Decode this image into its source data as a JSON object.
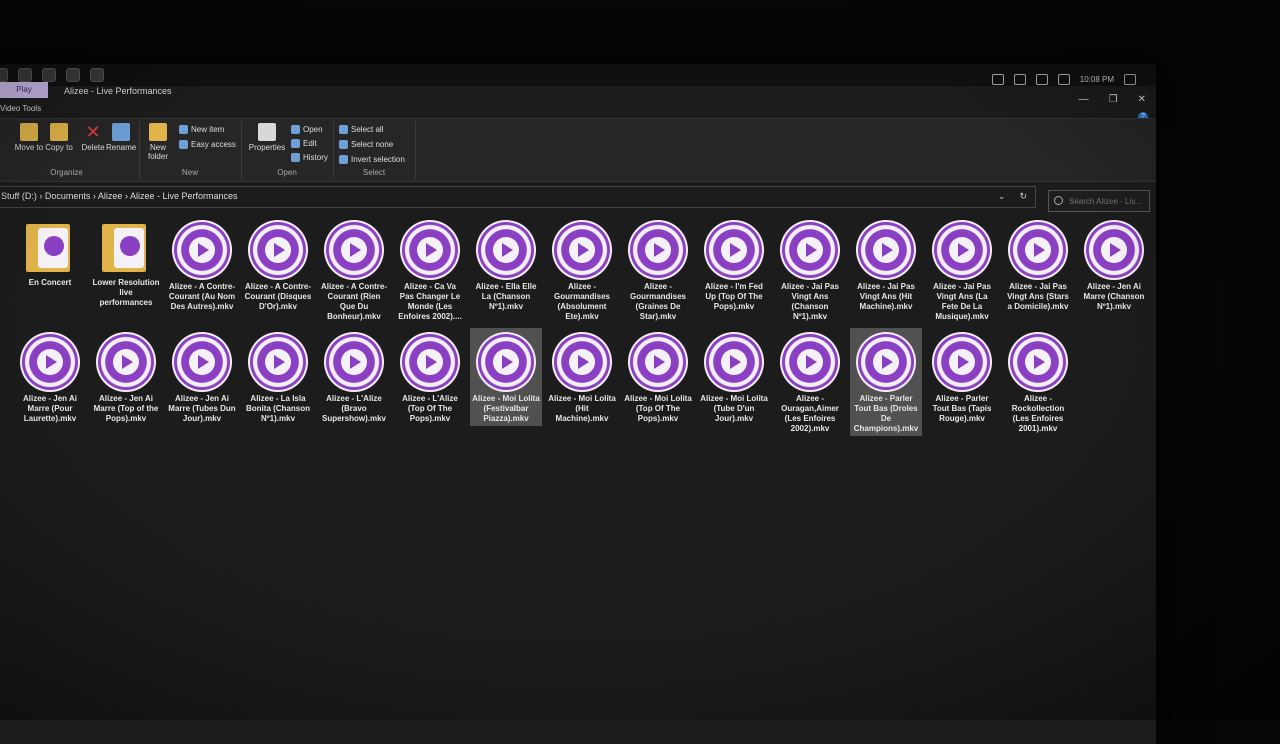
{
  "window": {
    "title": "Alizee - Live Performances",
    "context_tab": "Play",
    "context_group": "Video Tools",
    "clock": "10:08 PM"
  },
  "ribbon": {
    "organize": {
      "label": "Organize",
      "move_to": "Move to",
      "copy_to": "Copy to",
      "delete": "Delete",
      "rename": "Rename"
    },
    "new": {
      "label": "New",
      "new_folder": "New folder",
      "new_item": "New item",
      "easy_access": "Easy access"
    },
    "open": {
      "label": "Open",
      "properties": "Properties",
      "open": "Open",
      "edit": "Edit",
      "history": "History"
    },
    "select": {
      "label": "Select",
      "select_all": "Select all",
      "select_none": "Select none",
      "invert_selection": "Invert selection"
    }
  },
  "address": {
    "crumbs": [
      "Stuff (D:)",
      "Documents",
      "Alizee",
      "Alizee - Live Performances"
    ],
    "search_placeholder": "Search Alizee - Liv..."
  },
  "icons": {
    "play": "play-circle-icon",
    "folder": "folder-icon"
  },
  "colors": {
    "accent": "#8b3fc2",
    "background": "#1c1c1c",
    "selection": "#5a5a5a"
  },
  "items": [
    {
      "name": "En Concert",
      "kind": "folder",
      "selected": false
    },
    {
      "name": "Lower Resolution live performances",
      "kind": "folder",
      "selected": false
    },
    {
      "name": "Alizee - A Contre-Courant (Au Nom Des Autres).mkv",
      "kind": "video",
      "selected": false
    },
    {
      "name": "Alizee - A Contre-Courant (Disques D'Or).mkv",
      "kind": "video",
      "selected": false
    },
    {
      "name": "Alizee - A Contre-Courant (Rien Que Du Bonheur).mkv",
      "kind": "video",
      "selected": false
    },
    {
      "name": "Alizee - Ca Va Pas Changer Le Monde (Les Enfoires 2002)....",
      "kind": "video",
      "selected": false
    },
    {
      "name": "Alizee - Ella Elle La (Chanson Nº1).mkv",
      "kind": "video",
      "selected": false
    },
    {
      "name": "Alizee - Gourmandises (Absolument Ete).mkv",
      "kind": "video",
      "selected": false
    },
    {
      "name": "Alizee - Gourmandises (Graines De Star).mkv",
      "kind": "video",
      "selected": false
    },
    {
      "name": "Alizee - I'm Fed Up (Top Of The Pops).mkv",
      "kind": "video",
      "selected": false
    },
    {
      "name": "Alizee - Jai Pas Vingt Ans (Chanson Nº1).mkv",
      "kind": "video",
      "selected": false
    },
    {
      "name": "Alizee - Jai Pas Vingt Ans (Hit Machine).mkv",
      "kind": "video",
      "selected": false
    },
    {
      "name": "Alizee - Jai Pas Vingt Ans (La Fete De La Musique).mkv",
      "kind": "video",
      "selected": false
    },
    {
      "name": "Alizee - Jai Pas Vingt Ans (Stars a Domicile).mkv",
      "kind": "video",
      "selected": false
    },
    {
      "name": "Alizee - Jen Ai Marre (Chanson Nº1).mkv",
      "kind": "video",
      "selected": false
    },
    {
      "name": "Alizee - Jen Ai Marre (Pour Laurette).mkv",
      "kind": "video",
      "selected": false
    },
    {
      "name": "Alizee - Jen Ai Marre (Top of the Pops).mkv",
      "kind": "video",
      "selected": false
    },
    {
      "name": "Alizee - Jen Ai Marre (Tubes Dun Jour).mkv",
      "kind": "video",
      "selected": false
    },
    {
      "name": "Alizee - La Isla Bonita (Chanson Nº1).mkv",
      "kind": "video",
      "selected": false
    },
    {
      "name": "Alizee - L'Alize (Bravo Supershow).mkv",
      "kind": "video",
      "selected": false
    },
    {
      "name": "Alizee - L'Alize (Top Of The Pops).mkv",
      "kind": "video",
      "selected": false
    },
    {
      "name": "Alizee - Moi Lolita (Festivalbar Piazza).mkv",
      "kind": "video",
      "selected": true
    },
    {
      "name": "Alizee - Moi Lolita (Hit Machine).mkv",
      "kind": "video",
      "selected": false
    },
    {
      "name": "Alizee - Moi Lolita (Top Of The Pops).mkv",
      "kind": "video",
      "selected": false
    },
    {
      "name": "Alizee - Moi Lolita (Tube D'un Jour).mkv",
      "kind": "video",
      "selected": false
    },
    {
      "name": "Alizee - Ouragan,Aimer (Les Enfoires 2002).mkv",
      "kind": "video",
      "selected": false
    },
    {
      "name": "Alizee - Parler Tout Bas (Droles De Champions).mkv",
      "kind": "video",
      "selected": true
    },
    {
      "name": "Alizee - Parler Tout Bas (Tapis Rouge).mkv",
      "kind": "video",
      "selected": false
    },
    {
      "name": "Alizee - Rockollection (Les Enfoires 2001).mkv",
      "kind": "video",
      "selected": false
    }
  ]
}
